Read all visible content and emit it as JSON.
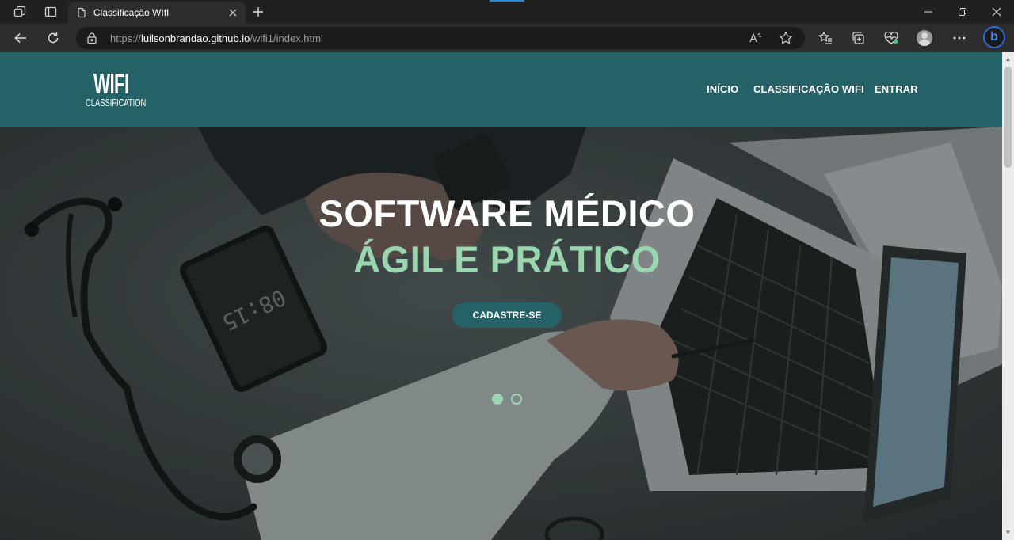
{
  "browser": {
    "tab_title": "Classificação WIfI",
    "url_prefix": "https://",
    "url_host": "luilsonbrandao.github.io",
    "url_path": "/wifi1/index.html"
  },
  "site": {
    "logo_main": "WIFI",
    "logo_sub": "CLASSIFICATION",
    "nav": [
      "INÍCIO",
      "CLASSIFICAÇÃO WIFI",
      "ENTRAR"
    ]
  },
  "hero": {
    "headline_line1": "SOFTWARE MÉDICO",
    "headline_line2": "ÁGIL E PRÁTICO",
    "cta_label": "CADASTRE-SE",
    "phone_clock": "08:15",
    "slides_total": 2,
    "slide_active": 1
  },
  "colors": {
    "brand_teal": "#246267",
    "accent_green": "#9bd7ae"
  },
  "icons": [
    "workspaces-icon",
    "tab-actions-icon",
    "page-icon",
    "close-icon",
    "plus-icon",
    "minimize-icon",
    "restore-icon",
    "close-window-icon",
    "back-icon",
    "refresh-icon",
    "lock-icon",
    "read-aloud-icon",
    "favorite-star-icon",
    "favorites-list-icon",
    "collections-icon",
    "performance-icon",
    "profile-avatar-icon",
    "more-icon",
    "bing-icon"
  ]
}
